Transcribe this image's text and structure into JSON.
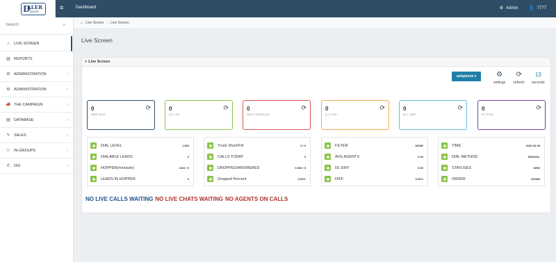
{
  "topbar": {
    "logo_text": "ALER",
    "logo_d": "D",
    "logo_sub": "DIALER",
    "dashboard_link": "Dashboard",
    "admin_label": "Admin",
    "user_label": "7777"
  },
  "sidebar": {
    "search_placeholder": "Search",
    "items": [
      {
        "label": "LIVE SCREEN",
        "icon": "home-icon",
        "chevron": ""
      },
      {
        "label": "REPORTS",
        "icon": "chart-icon",
        "chevron": ""
      },
      {
        "label": "ADMINISTRATION",
        "icon": "gear-icon",
        "chevron": "‹"
      },
      {
        "label": "ADMINISTRATION",
        "icon": "gear-icon",
        "chevron": "‹"
      },
      {
        "label": "THE CAMPAIGN",
        "icon": "megaphone-icon",
        "chevron": "‹"
      },
      {
        "label": "DATABASE",
        "icon": "database-icon",
        "chevron": "‹"
      },
      {
        "label": "SALES",
        "icon": "tag-icon",
        "chevron": "‹"
      },
      {
        "label": "IN-GROUPS",
        "icon": "users-icon",
        "chevron": "‹"
      },
      {
        "label": "DID",
        "icon": "phone-icon",
        "chevron": "‹"
      }
    ]
  },
  "breadcrumb": {
    "home": "Live Screen",
    "current": "Live Screen"
  },
  "page_title": "Live Screen",
  "panel": {
    "title": "Live Screen",
    "phone_button": "webphone ▾",
    "settings_label": "settings",
    "refresh_label": "refresh",
    "seconds_value": "13",
    "seconds_label": "seconds"
  },
  "stats": [
    {
      "value": "0",
      "label": "NEW SALE",
      "color": "#2f4d66"
    },
    {
      "value": "0",
      "label": "Q.C. OK",
      "color": "#8bc34a"
    },
    {
      "value": "0",
      "label": "SALE CANCELED",
      "color": "#d9534f"
    },
    {
      "value": "0",
      "label": "Q.C. M.D.",
      "color": "#f0ad4e"
    },
    {
      "value": "0",
      "label": "Q.C. EMP",
      "color": "#5bc0de"
    },
    {
      "value": "0",
      "label": "IN TOTAL",
      "color": "#6f42a1"
    }
  ],
  "info_boxes": [
    [
      {
        "key": "DIAL LEVEL",
        "value": "1.500"
      },
      {
        "key": "DIALABLE LEADS",
        "value": "0"
      },
      {
        "key": "HOPPER(min/auto)",
        "value": "1001 / 0"
      },
      {
        "key": "LEADS IN HOPPER",
        "value": "0"
      }
    ],
    [
      {
        "key": "Trunk Short/Fill",
        "value": "0 / 0"
      },
      {
        "key": "CALLS TODAY",
        "value": "0"
      },
      {
        "key": "DROPPED/ANSWERED",
        "value": "0.000 / 0"
      },
      {
        "key": "Dropped Percent",
        "value": "0.00%"
      }
    ],
    [
      {
        "key": "FILTER",
        "value": "NONE"
      },
      {
        "key": "AVG AGENTS",
        "value": "0.00"
      },
      {
        "key": "DL DIFF",
        "value": "0.00"
      },
      {
        "key": "DIFF",
        "value": "0.00%"
      }
    ],
    [
      {
        "key": "TIME",
        "value": "2020-03-08"
      },
      {
        "key": "DIAL METHOD",
        "value": "MANUAL"
      },
      {
        "key": "STATUSES",
        "value": "NEW"
      },
      {
        "key": "ORDER",
        "value": "DOWN"
      }
    ]
  ],
  "status": {
    "calls": "NO LIVE CALLS WAITING",
    "chats": "NO LIVE CHATS WAITING",
    "agents": "NO AGENTS ON CALLS"
  }
}
